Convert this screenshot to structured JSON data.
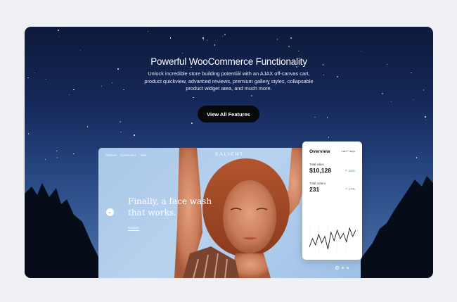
{
  "hero": {
    "title": "Powerful WooCommerce Functionality",
    "description": "Unlock incredible store building potential with an AJAX off-canvas cart, product quickview, advanced reviews, premium gallery styles, collapsable product widget area, and much more.",
    "cta_label": "View All Features"
  },
  "store": {
    "nav_links": [
      "Skincare",
      "Accessories",
      "New"
    ],
    "brand": "SALIENT",
    "headline": "Finally, a face wash that works.",
    "explore_label": "Explore",
    "prev_arrow": "←"
  },
  "overview": {
    "title": "Overview",
    "period": "Last 7 days",
    "total_sales_label": "Total sales",
    "total_sales_value": "$10,128",
    "total_sales_change": "↗ 24%",
    "total_orders_label": "Total orders",
    "total_orders_value": "231",
    "total_orders_change": "↗ 17%",
    "sparkline": [
      14,
      22,
      16,
      26,
      18,
      24,
      12,
      28,
      20,
      30,
      22,
      27,
      19,
      32,
      24,
      30
    ]
  },
  "colors": {
    "accent_positive": "#3aa55a",
    "button_dark": "#08090d"
  }
}
